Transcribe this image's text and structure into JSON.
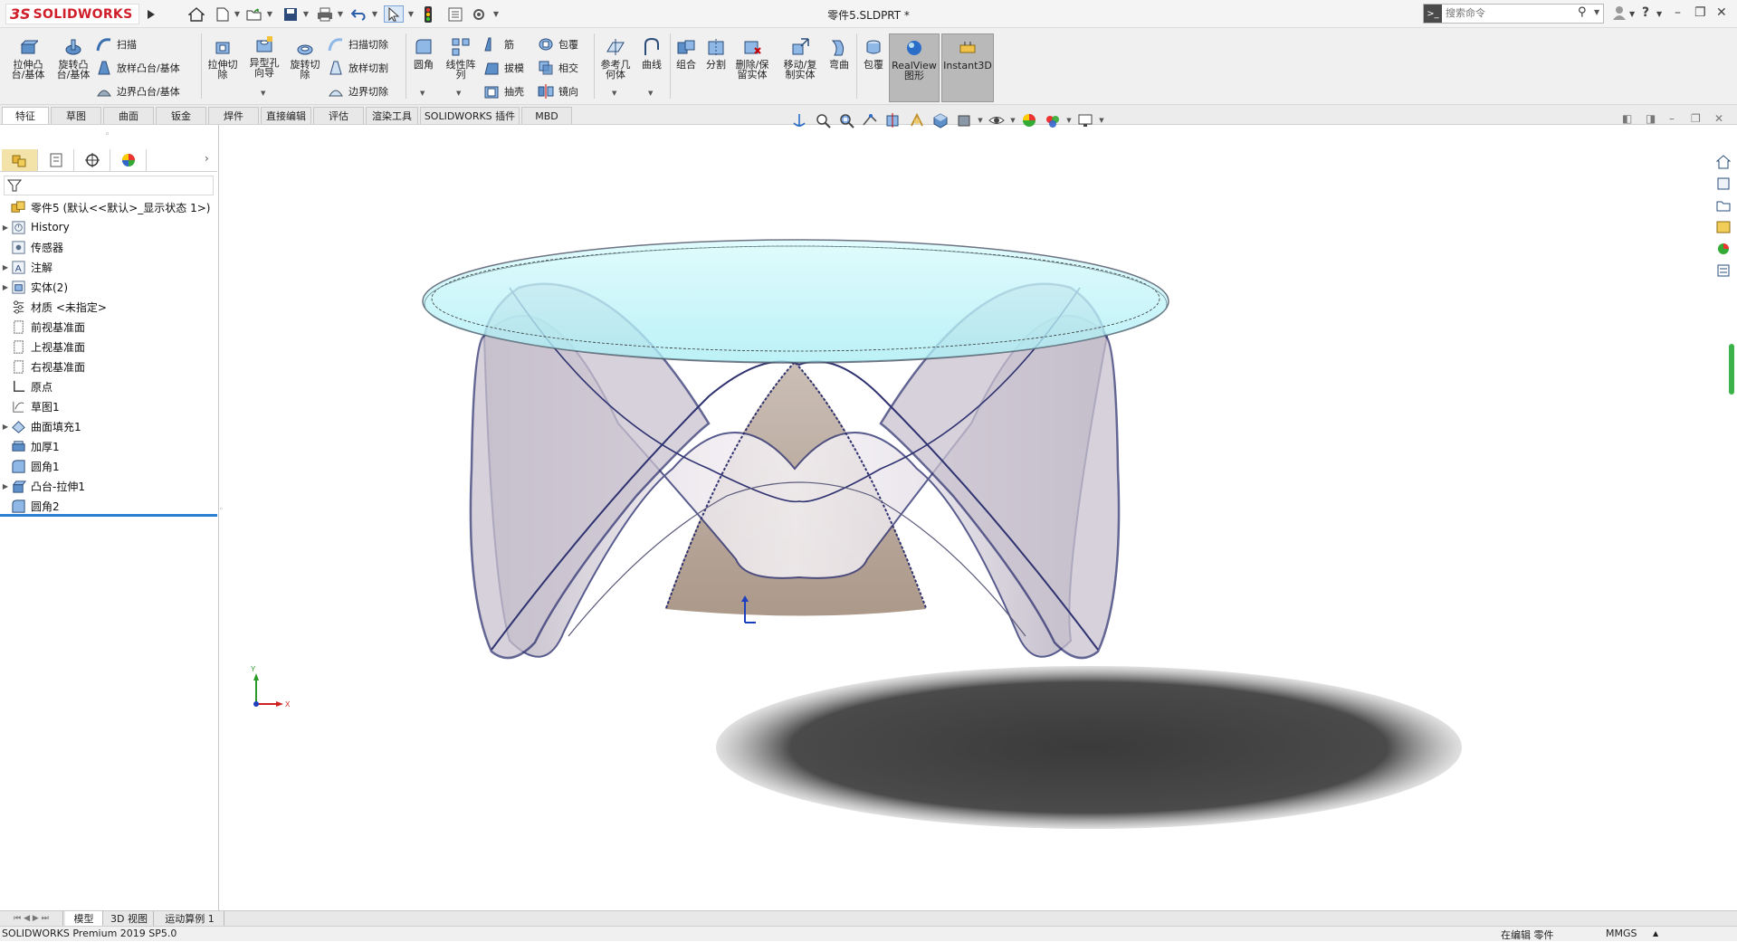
{
  "app": {
    "logo_ds": "3S",
    "logo_name": "SOLIDWORKS"
  },
  "window": {
    "document_title": "零件5.SLDPRT *"
  },
  "search": {
    "placeholder": "搜索命令"
  },
  "commands": {
    "extrude_boss": "拉伸凸台/基体",
    "revolve_boss": "旋转凸台/基体",
    "sweep": "扫描",
    "loft_boss": "放样凸台/基体",
    "boundary_boss": "边界凸台/基体",
    "extrude_cut": "拉伸切除",
    "hole_wizard": "异型孔向导",
    "revolve_cut": "旋转切除",
    "sweep_cut": "扫描切除",
    "loft_cut": "放样切割",
    "boundary_cut": "边界切除",
    "fillet": "圆角",
    "linear_pattern": "线性阵列",
    "rib": "筋",
    "draft": "拔模",
    "shell": "抽壳",
    "wrap": "包覆",
    "intersect": "相交",
    "mirror": "镜向",
    "ref_geometry": "参考几何体",
    "curves": "曲线",
    "combine": "组合",
    "split": "分割",
    "delete_keep_body": "删除/保留实体",
    "move_copy_body": "移动/复制实体",
    "flex": "弯曲",
    "wrap2": "包覆",
    "realview": "RealView图形",
    "instant3d": "Instant3D"
  },
  "cmd_tabs": [
    "特征",
    "草图",
    "曲面",
    "钣金",
    "焊件",
    "直接编辑",
    "评估",
    "渲染工具",
    "SOLIDWORKS 插件",
    "MBD"
  ],
  "tree": {
    "root": "零件5 (默认<<默认>_显示状态 1>)",
    "items": [
      {
        "label": "History",
        "expandable": true
      },
      {
        "label": "传感器",
        "expandable": false
      },
      {
        "label": "注解",
        "expandable": true
      },
      {
        "label": "实体(2)",
        "expandable": true
      },
      {
        "label": "材质 <未指定>",
        "expandable": false
      },
      {
        "label": "前视基准面",
        "expandable": false
      },
      {
        "label": "上视基准面",
        "expandable": false
      },
      {
        "label": "右视基准面",
        "expandable": false
      },
      {
        "label": "原点",
        "expandable": false
      },
      {
        "label": "草图1",
        "expandable": false
      },
      {
        "label": "曲面填充1",
        "expandable": true
      },
      {
        "label": "加厚1",
        "expandable": false
      },
      {
        "label": "圆角1",
        "expandable": false
      },
      {
        "label": "凸台-拉伸1",
        "expandable": true
      },
      {
        "label": "圆角2",
        "expandable": false
      }
    ]
  },
  "bottom_tabs": [
    "模型",
    "3D 视图",
    "运动算例 1"
  ],
  "status": {
    "product": "SOLIDWORKS Premium 2019 SP5.0",
    "editing": "在编辑 零件",
    "units": "MMGS"
  },
  "colors": {
    "accent": "#2a7ed4",
    "brand_red": "#d01e2a",
    "glass": "#c8f6fb"
  }
}
